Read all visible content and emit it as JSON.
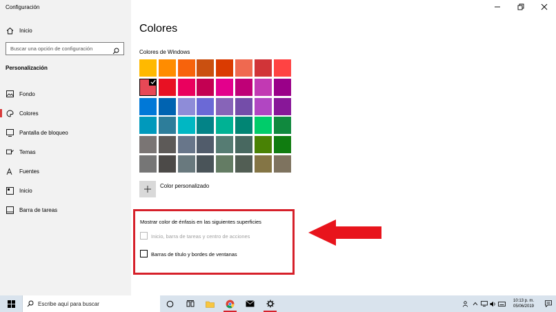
{
  "app_title": "Configuración",
  "sidebar": {
    "home_label": "Inicio",
    "search_placeholder": "Buscar una opción de configuración",
    "section_label": "Personalización",
    "items": [
      {
        "label": "Fondo",
        "icon": "picture-icon",
        "active": false
      },
      {
        "label": "Colores",
        "icon": "palette-icon",
        "active": true
      },
      {
        "label": "Pantalla de bloqueo",
        "icon": "lock-screen-icon",
        "active": false
      },
      {
        "label": "Temas",
        "icon": "brush-icon",
        "active": false
      },
      {
        "label": "Fuentes",
        "icon": "font-icon",
        "active": false
      },
      {
        "label": "Inicio",
        "icon": "start-menu-icon",
        "active": false
      },
      {
        "label": "Barra de tareas",
        "icon": "taskbar-icon",
        "active": false
      }
    ]
  },
  "main": {
    "title": "Colores",
    "windows_colors_label": "Colores de Windows",
    "swatches": [
      "#ffb900",
      "#ff8c00",
      "#f7630c",
      "#ca5010",
      "#da3b01",
      "#ef6950",
      "#d13438",
      "#ff4343",
      "#e74856",
      "#e81123",
      "#ea005e",
      "#c30052",
      "#e3008c",
      "#bf0077",
      "#c239b3",
      "#9a0089",
      "#0078d7",
      "#0063b1",
      "#8e8cd8",
      "#6b69d6",
      "#8764b8",
      "#744da9",
      "#b146c2",
      "#881798",
      "#0099bc",
      "#2d7d9a",
      "#00b7c3",
      "#038387",
      "#00b294",
      "#018574",
      "#00cc6a",
      "#10893e",
      "#7a7574",
      "#5d5a58",
      "#68768a",
      "#515c6b",
      "#567c73",
      "#486860",
      "#498205",
      "#107c10",
      "#767676",
      "#4c4a48",
      "#69797e",
      "#4a5459",
      "#647c64",
      "#525e54",
      "#847545",
      "#7e735f"
    ],
    "selected_swatch_index": 8,
    "custom_color_label": "Color personalizado",
    "accent_surfaces_label": "Mostrar color de énfasis en las siguientes superficies",
    "checkbox_start": {
      "label": "Inicio, barra de tareas y centro de acciones",
      "checked": false,
      "disabled": true
    },
    "checkbox_titlebars": {
      "label": "Barras de título y bordes de ventanas",
      "checked": false,
      "disabled": false
    },
    "highlight_color": "#d6202a"
  },
  "taskbar": {
    "search_placeholder": "Escribe aquí para buscar",
    "clock_time": "10:13 p. m.",
    "clock_date": "05/06/2019",
    "background": "#d9e3ed"
  }
}
